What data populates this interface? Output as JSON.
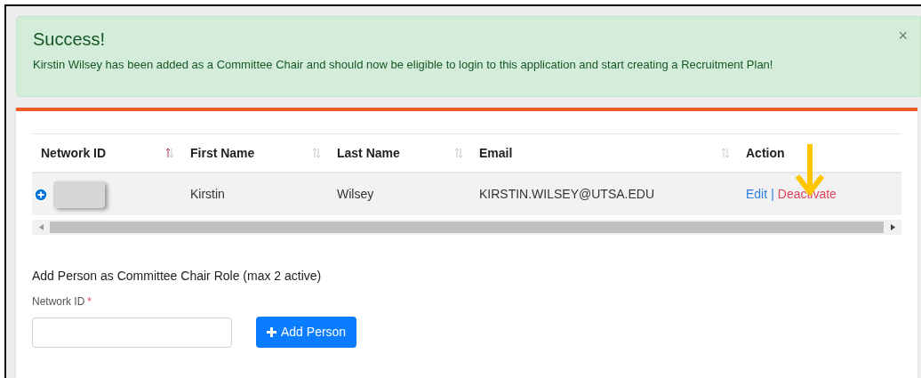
{
  "alert": {
    "title": "Success!",
    "message": "Kirstin Wilsey has been added as a Committee Chair and should now be eligible to login to this application and start creating a Recruitment Plan!",
    "close": "×"
  },
  "table": {
    "columns": [
      {
        "label": "Network ID",
        "sortable": true,
        "sorted": true
      },
      {
        "label": "First Name",
        "sortable": true,
        "sorted": false
      },
      {
        "label": "Last Name",
        "sortable": true,
        "sorted": false
      },
      {
        "label": "Email",
        "sortable": true,
        "sorted": false
      },
      {
        "label": "Action",
        "sortable": false
      }
    ],
    "rows": [
      {
        "first_name": "Kirstin",
        "last_name": "Wilsey",
        "email": "KIRSTIN.WILSEY@UTSA.EDU",
        "actions": [
          "Edit",
          "Deactivate"
        ],
        "separator": "|"
      }
    ]
  },
  "form": {
    "heading": "Add Person as Committee Chair Role (max 2 active)",
    "field_label": "Network ID",
    "required_mark": "*",
    "button": "Add Person"
  }
}
